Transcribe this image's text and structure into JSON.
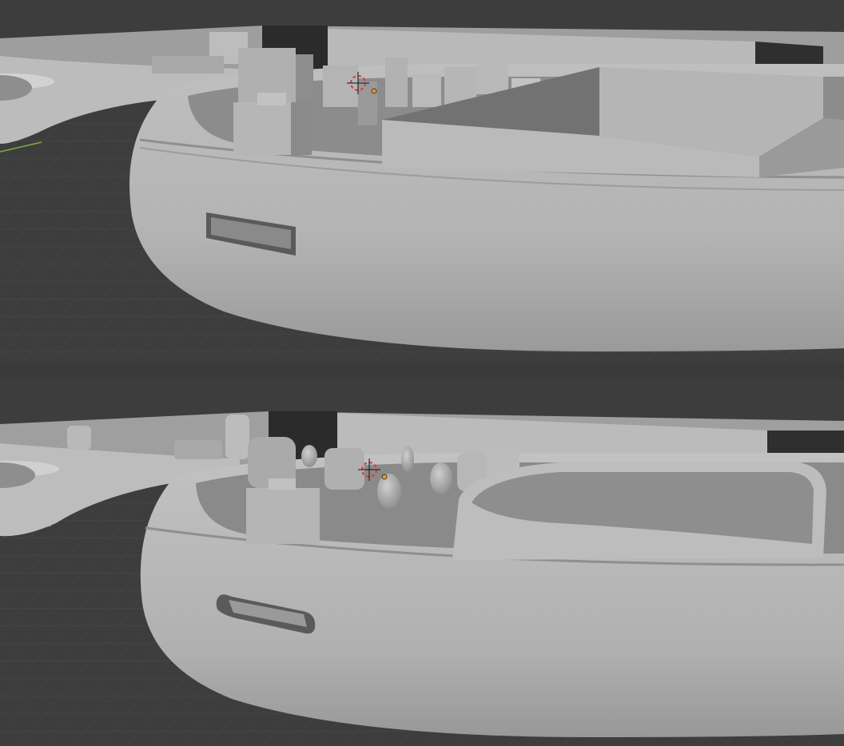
{
  "app": {
    "name": "3D Viewport",
    "theme_colors": {
      "background": "#3d3d3d",
      "grid_line": "#474747",
      "grid_dark": "#353535",
      "mesh_light": "#c4c4c4",
      "mesh_mid": "#a8a8a8",
      "mesh_dark": "#7f7f7f",
      "x_axis": "#80b040",
      "cursor_red": "#d23b3b",
      "origin": "#e79a2a"
    }
  },
  "viewports": [
    {
      "id": "top",
      "shading": "solid",
      "model": "enclosure-blocky",
      "icons": [
        "3d-cursor-icon",
        "origin-point-icon"
      ]
    },
    {
      "id": "bottom",
      "shading": "solid",
      "model": "enclosure-smooth",
      "icons": [
        "3d-cursor-icon",
        "origin-point-icon"
      ]
    }
  ]
}
